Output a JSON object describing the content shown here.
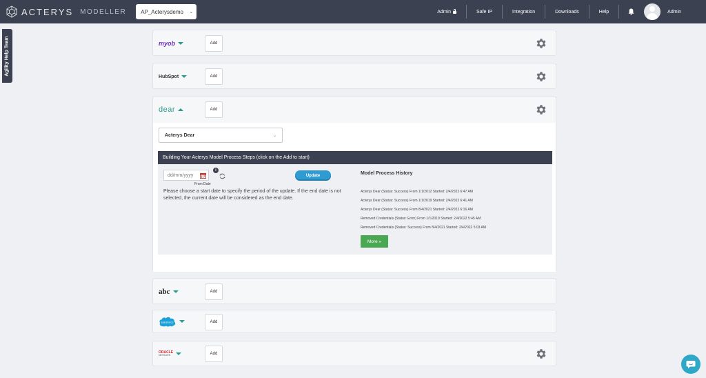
{
  "header": {
    "brand": "ACTERYS",
    "product": "MODELLER",
    "model_select": "AP_Acterysdemo",
    "nav": [
      "Admin",
      "Safe IP",
      "Integration",
      "Downloads",
      "Help"
    ],
    "user": "Admin"
  },
  "help_tab": "Agility Help Team",
  "connectors": [
    {
      "logo": "myob",
      "add": "Add"
    },
    {
      "logo": "HubSpot",
      "add": "Add"
    },
    {
      "logo": "dear",
      "add": "Add"
    },
    {
      "logo": "abc",
      "add": "Add"
    },
    {
      "logo": "salesforce",
      "add": "Add"
    },
    {
      "logo_line1": "ORACLE",
      "logo_line2": "NETSUITE",
      "add": "Add"
    }
  ],
  "dear_panel": {
    "account_select": "Acterys Dear",
    "steps_header": "Building Your Acterys Model Process Steps (click on the Add to start)",
    "date_placeholder": "dd/mm/yyyy",
    "from_label": "From Date",
    "info": "i",
    "update_label": "Update",
    "description": "Please choose a start date to specify the period of the update. If the end date is not selected, the current date will be considered as the end date.",
    "history_title": "Model Process History",
    "history": [
      "Acterys Dear (Status: Success) From 1/1/2012 Started: 2/4/2022 6:47 AM",
      "Acterys Dear (Status: Success) From 1/1/2019 Started: 2/4/2022 6:41 AM",
      "Acterys Dear (Status: Success) From 8/4/2021 Started: 2/4/2022 6:16 AM",
      "Removed Credentials (Status: Error) From 1/1/2019 Started: 2/4/2022 5:45 AM",
      "Removed Credentials (Status: Success) From 8/4/2021 Started: 2/4/2022 5:03 AM"
    ],
    "more_label": "More »"
  },
  "colors": {
    "topbar": "#3b4150",
    "accent": "#2a9d8f",
    "update": "#2f9bd1",
    "more": "#4aa852",
    "chat": "#2ea8c9"
  }
}
